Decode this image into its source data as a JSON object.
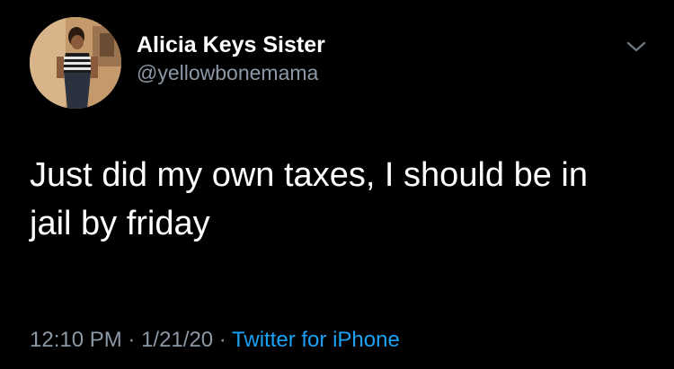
{
  "tweet": {
    "author": {
      "display_name": "Alicia Keys Sister",
      "handle": "@yellowbonemama",
      "avatar_icon": "profile-photo"
    },
    "more_icon": "chevron-down-icon",
    "text_line1": "Just did my own taxes, I should be in",
    "text_line2": "jail by friday",
    "time": "12:10 PM",
    "separator": " · ",
    "date": "1/21/20",
    "source": "Twitter for iPhone"
  },
  "colors": {
    "background": "#000000",
    "primary_text": "#ffffff",
    "secondary_text": "#8b98a5",
    "link": "#1da1f2"
  }
}
